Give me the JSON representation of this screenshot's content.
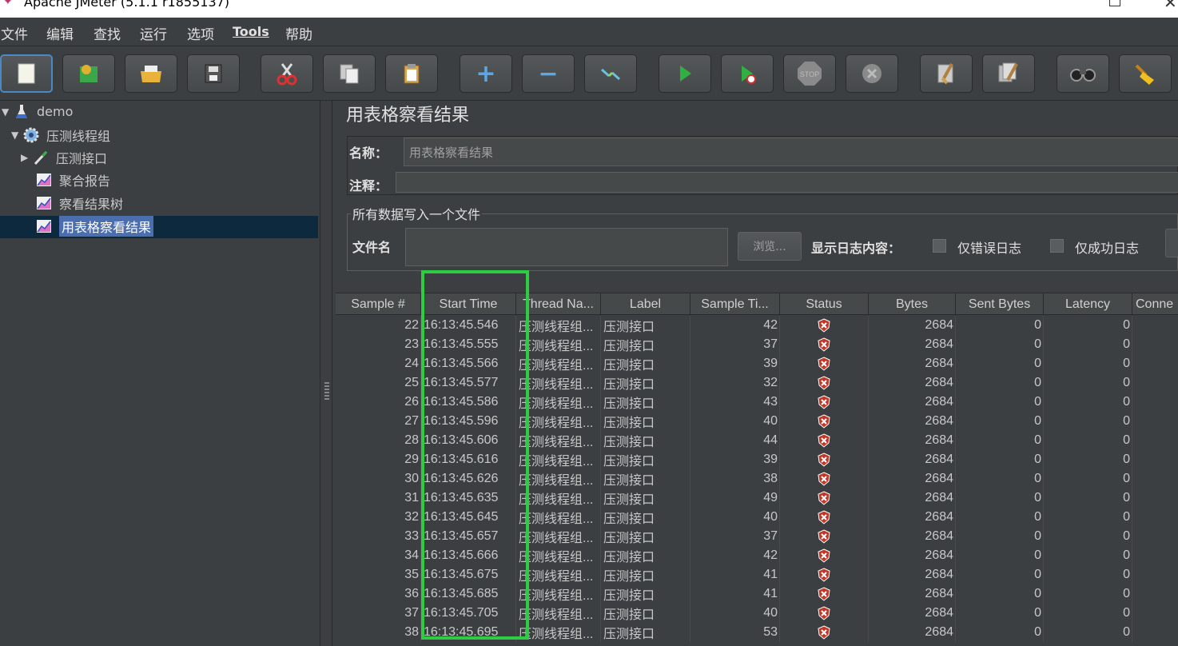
{
  "window": {
    "title": "Apache JMeter (5.1.1 r1855137)"
  },
  "menu": [
    "文件",
    "编辑",
    "查找",
    "运行",
    "选项",
    "Tools",
    "帮助"
  ],
  "toolbar": {
    "buttons": [
      "new-icon",
      "templates-icon",
      "open-icon",
      "save-icon",
      "cut-icon",
      "copy-icon",
      "paste-icon",
      "expand-icon",
      "collapse-icon",
      "toggle-icon",
      "start-icon",
      "start-no-pause-icon",
      "stop-icon",
      "shutdown-icon",
      "clear-icon",
      "clear-all-icon",
      "search-icon",
      "reset-search-icon"
    ]
  },
  "tree": {
    "items": [
      {
        "label": "demo",
        "icon": "test-plan-icon"
      },
      {
        "label": "压测线程组",
        "icon": "thread-group-icon"
      },
      {
        "label": "压测接口",
        "icon": "sampler-icon"
      },
      {
        "label": "聚合报告",
        "icon": "listener-icon"
      },
      {
        "label": "察看结果树",
        "icon": "listener-icon"
      },
      {
        "label": "用表格察看结果",
        "icon": "listener-icon"
      }
    ]
  },
  "panel": {
    "title": "用表格察看结果",
    "name_label": "名称：",
    "name_value": "用表格察看结果",
    "comment_label": "注释：",
    "fieldset_legend": "所有数据写入一个文件",
    "filename_label": "文件名",
    "browse_label": "浏览...",
    "log_label": "显示日志内容：",
    "errors_only_label": "仅错误日志",
    "success_only_label": "仅成功日志"
  },
  "table": {
    "columns": [
      "Sample #",
      "Start Time",
      "Thread Na...",
      "Label",
      "Sample Ti...",
      "Status",
      "Bytes",
      "Sent Bytes",
      "Latency",
      "Conne"
    ],
    "rows": [
      [
        "22",
        "16:13:45.546",
        "压测线程组...",
        "压测接口",
        "42",
        "error",
        "2684",
        "0",
        "0"
      ],
      [
        "23",
        "16:13:45.555",
        "压测线程组...",
        "压测接口",
        "37",
        "error",
        "2684",
        "0",
        "0"
      ],
      [
        "24",
        "16:13:45.566",
        "压测线程组...",
        "压测接口",
        "39",
        "error",
        "2684",
        "0",
        "0"
      ],
      [
        "25",
        "16:13:45.577",
        "压测线程组...",
        "压测接口",
        "32",
        "error",
        "2684",
        "0",
        "0"
      ],
      [
        "26",
        "16:13:45.586",
        "压测线程组...",
        "压测接口",
        "43",
        "error",
        "2684",
        "0",
        "0"
      ],
      [
        "27",
        "16:13:45.596",
        "压测线程组...",
        "压测接口",
        "40",
        "error",
        "2684",
        "0",
        "0"
      ],
      [
        "28",
        "16:13:45.606",
        "压测线程组...",
        "压测接口",
        "44",
        "error",
        "2684",
        "0",
        "0"
      ],
      [
        "29",
        "16:13:45.616",
        "压测线程组...",
        "压测接口",
        "39",
        "error",
        "2684",
        "0",
        "0"
      ],
      [
        "30",
        "16:13:45.626",
        "压测线程组...",
        "压测接口",
        "38",
        "error",
        "2684",
        "0",
        "0"
      ],
      [
        "31",
        "16:13:45.635",
        "压测线程组...",
        "压测接口",
        "49",
        "error",
        "2684",
        "0",
        "0"
      ],
      [
        "32",
        "16:13:45.645",
        "压测线程组...",
        "压测接口",
        "40",
        "error",
        "2684",
        "0",
        "0"
      ],
      [
        "33",
        "16:13:45.657",
        "压测线程组...",
        "压测接口",
        "37",
        "error",
        "2684",
        "0",
        "0"
      ],
      [
        "34",
        "16:13:45.666",
        "压测线程组...",
        "压测接口",
        "42",
        "error",
        "2684",
        "0",
        "0"
      ],
      [
        "35",
        "16:13:45.675",
        "压测线程组...",
        "压测接口",
        "41",
        "error",
        "2684",
        "0",
        "0"
      ],
      [
        "36",
        "16:13:45.685",
        "压测线程组...",
        "压测接口",
        "41",
        "error",
        "2684",
        "0",
        "0"
      ],
      [
        "37",
        "16:13:45.705",
        "压测线程组...",
        "压测接口",
        "40",
        "error",
        "2684",
        "0",
        "0"
      ],
      [
        "38",
        "16:13:45.695",
        "压测线程组...",
        "压测接口",
        "53",
        "error",
        "2684",
        "0",
        "0"
      ]
    ]
  },
  "colors": {
    "background": "#3c3f41",
    "selection": "#4b6eaf",
    "highlight": "#2ecc40",
    "error": "#c0392b"
  }
}
